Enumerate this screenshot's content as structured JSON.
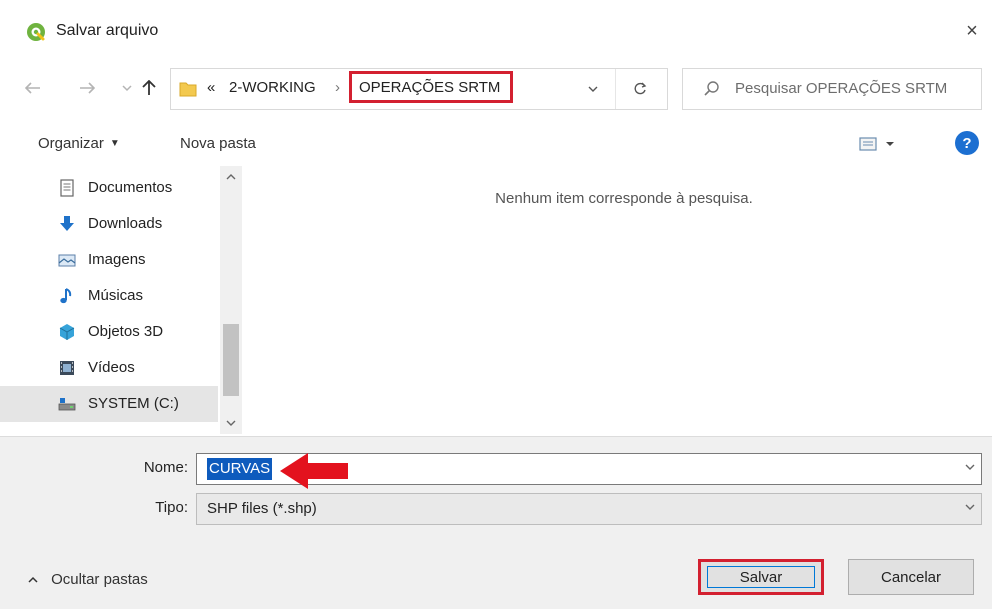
{
  "window": {
    "title": "Salvar arquivo",
    "close_glyph": "×"
  },
  "address": {
    "breadcrumb_prefix": "«",
    "parent_folder": "2-WORKING",
    "separator": "›",
    "current_folder": "OPERAÇÕES SRTM",
    "search_placeholder": "Pesquisar OPERAÇÕES SRTM"
  },
  "commands": {
    "organize": "Organizar",
    "new_folder": "Nova pasta",
    "help_glyph": "?"
  },
  "nav_pane": {
    "items": [
      {
        "label": "Documentos",
        "icon": "document-icon"
      },
      {
        "label": "Downloads",
        "icon": "download-arrow-icon"
      },
      {
        "label": "Imagens",
        "icon": "images-icon"
      },
      {
        "label": "Músicas",
        "icon": "music-note-icon"
      },
      {
        "label": "Objetos 3D",
        "icon": "cube-3d-icon"
      },
      {
        "label": "Vídeos",
        "icon": "video-film-icon"
      },
      {
        "label": "SYSTEM (C:)",
        "icon": "drive-icon",
        "selected": true
      }
    ]
  },
  "file_list": {
    "empty_message": "Nenhum item corresponde à pesquisa."
  },
  "form": {
    "name_label": "Nome:",
    "name_value": "CURVAS",
    "type_label": "Tipo:",
    "type_value": "SHP files (*.shp)"
  },
  "footer": {
    "hide_folders": "Ocultar pastas",
    "save": "Salvar",
    "cancel": "Cancelar"
  },
  "colors": {
    "highlight_red": "#d32030",
    "selection_blue": "#0e5bbd",
    "help_blue": "#1c6fd1",
    "qgis_green": "#6fb33f"
  }
}
